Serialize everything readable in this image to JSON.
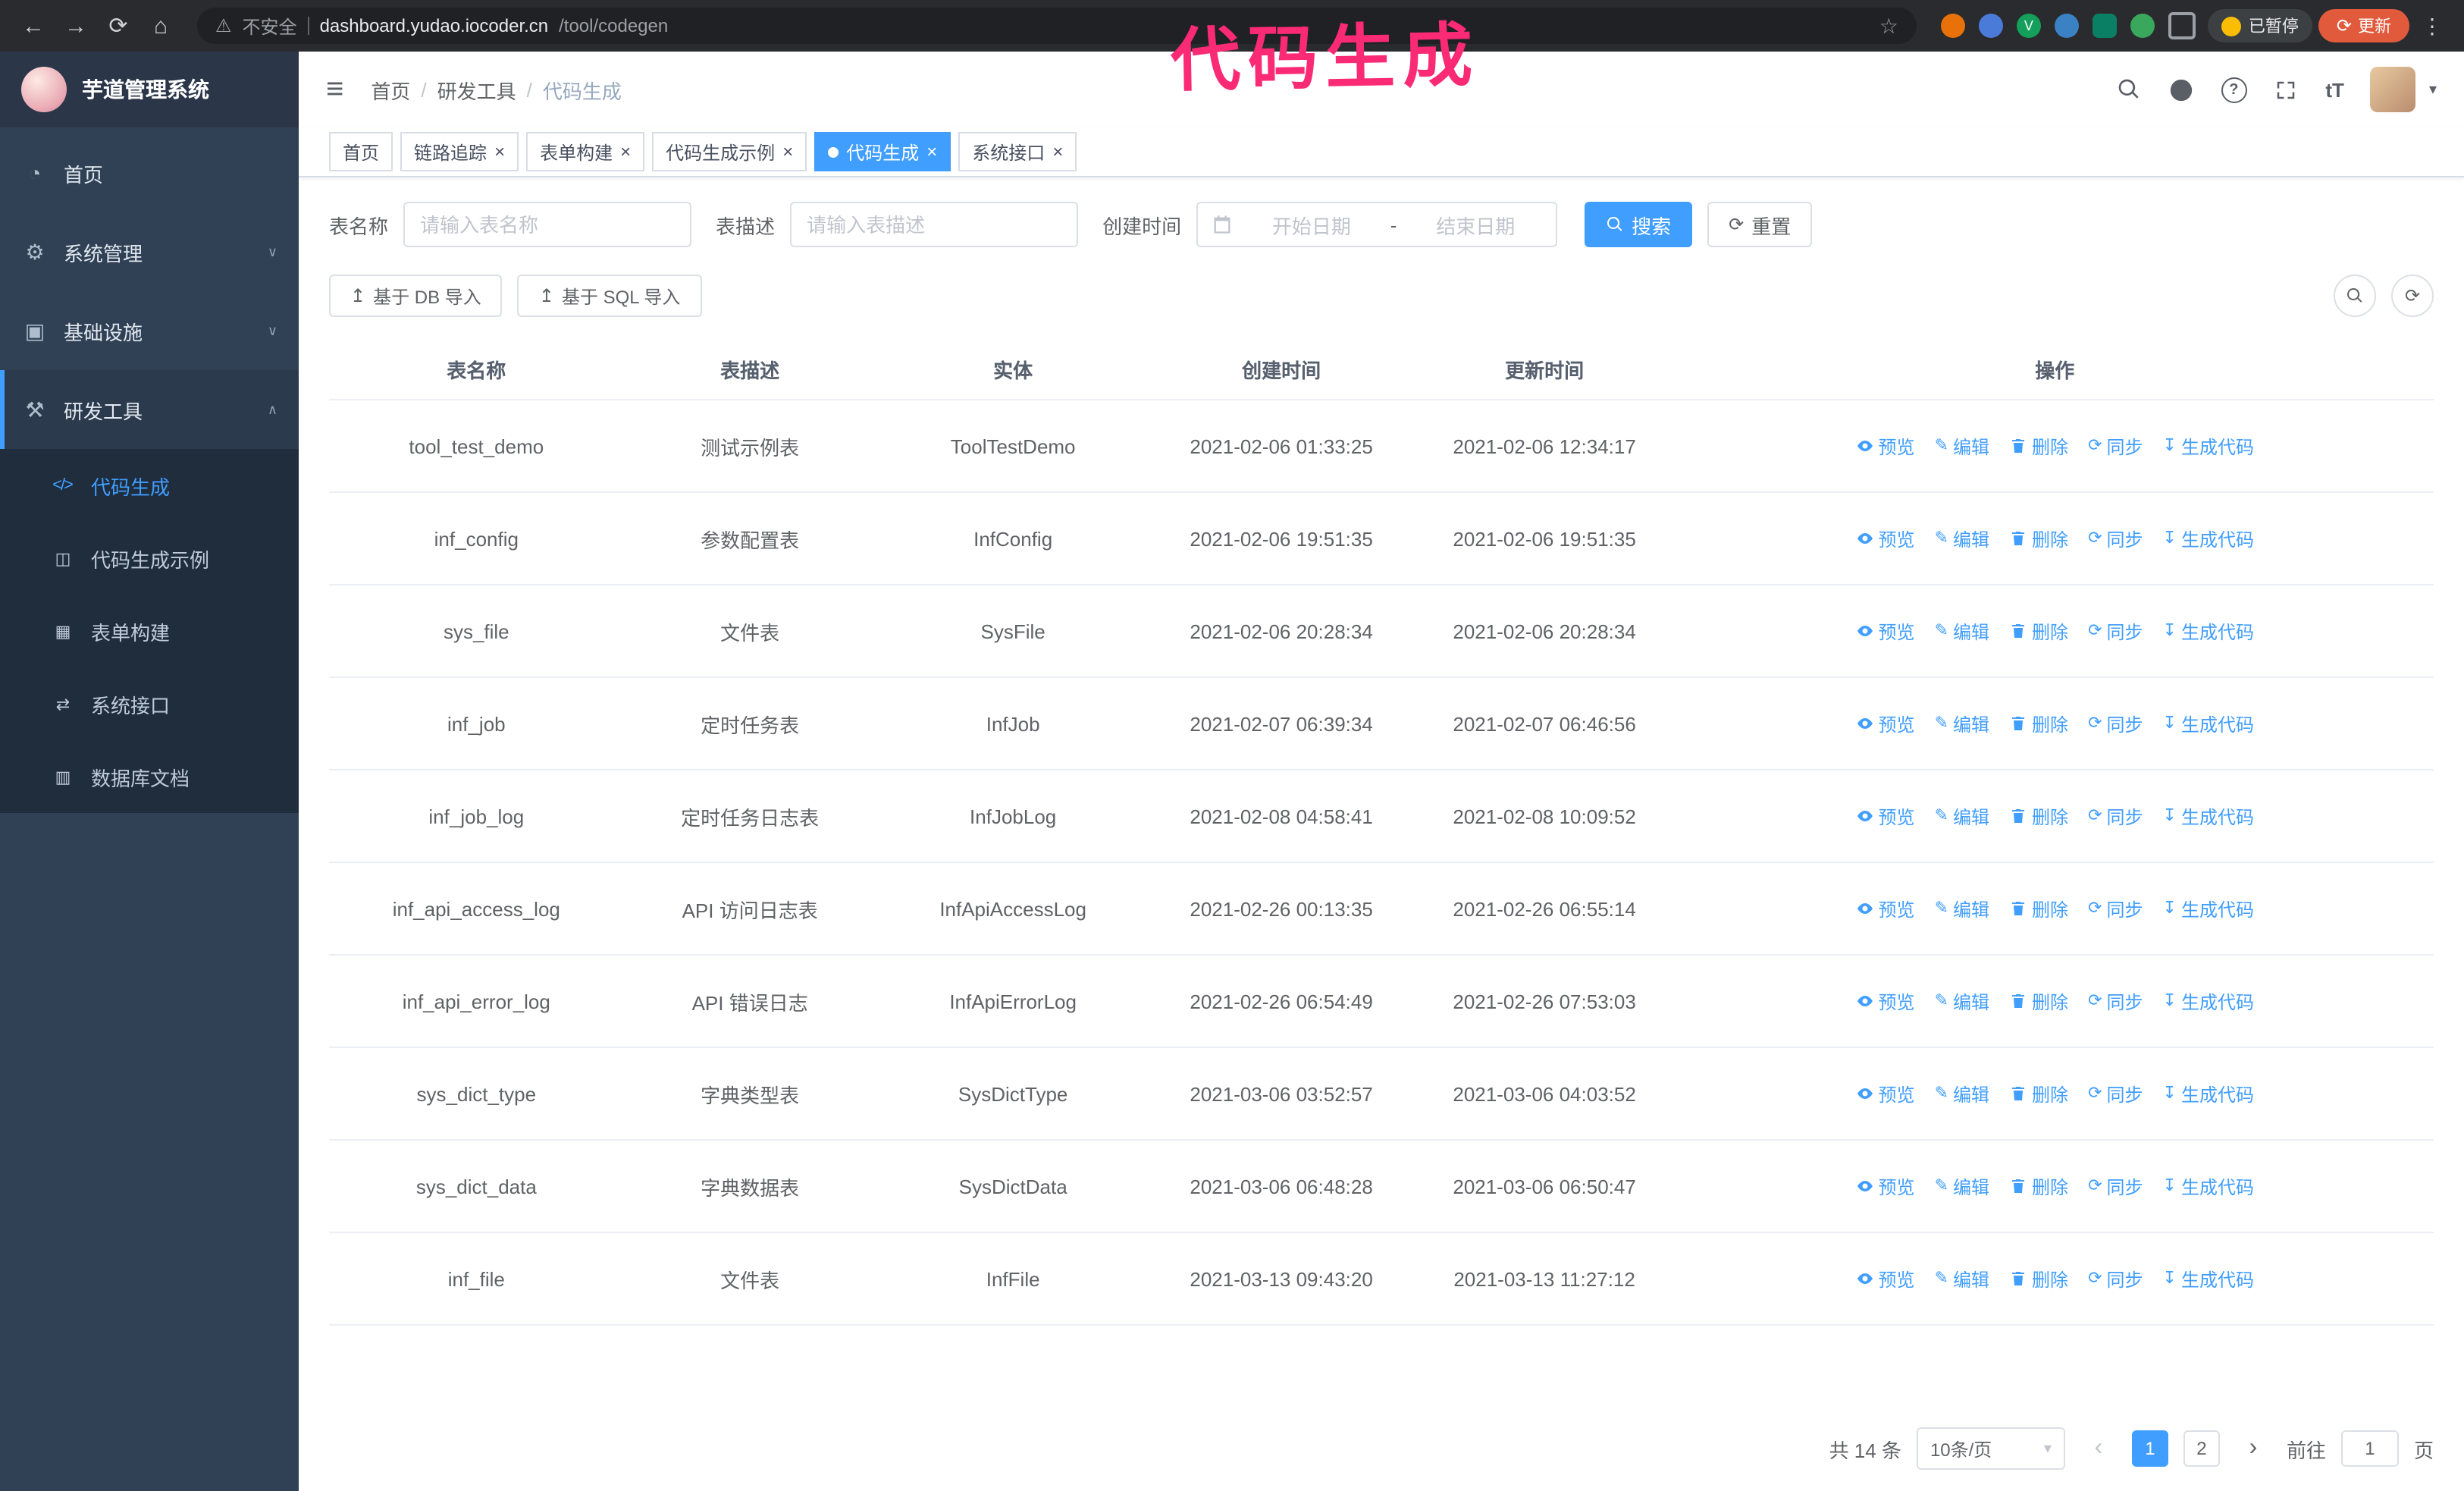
{
  "browser": {
    "security_label": "不安全",
    "url_host": "dashboard.yudao.iocoder.cn",
    "url_path": "/tool/codegen",
    "paused_badge": "已暂停",
    "update_button": "更新",
    "extension_badge_v": "V"
  },
  "annotation": "代码生成",
  "sidebar": {
    "logo_title": "芋道管理系统",
    "items": [
      {
        "label": "首页"
      },
      {
        "label": "系统管理"
      },
      {
        "label": "基础设施"
      },
      {
        "label": "研发工具"
      }
    ],
    "subitems": [
      {
        "label": "代码生成",
        "active": true
      },
      {
        "label": "代码生成示例"
      },
      {
        "label": "表单构建"
      },
      {
        "label": "系统接口"
      },
      {
        "label": "数据库文档"
      }
    ]
  },
  "header": {
    "breadcrumb": [
      "首页",
      "研发工具",
      "代码生成"
    ]
  },
  "tabs": [
    {
      "label": "首页"
    },
    {
      "label": "链路追踪"
    },
    {
      "label": "表单构建"
    },
    {
      "label": "代码生成示例"
    },
    {
      "label": "代码生成"
    },
    {
      "label": "系统接口"
    }
  ],
  "filters": {
    "table_name_label": "表名称",
    "table_name_placeholder": "请输入表名称",
    "table_desc_label": "表描述",
    "table_desc_placeholder": "请输入表描述",
    "create_time_label": "创建时间",
    "date_start_placeholder": "开始日期",
    "date_separator": "-",
    "date_end_placeholder": "结束日期",
    "search_button": "搜索",
    "reset_button": "重置"
  },
  "toolbar": {
    "import_db_button": "基于 DB 导入",
    "import_sql_button": "基于 SQL 导入"
  },
  "table": {
    "columns": [
      "表名称",
      "表描述",
      "实体",
      "创建时间",
      "更新时间",
      "操作"
    ],
    "ops": [
      "预览",
      "编辑",
      "删除",
      "同步",
      "生成代码"
    ],
    "rows": [
      {
        "name": "tool_test_demo",
        "desc": "测试示例表",
        "entity": "ToolTestDemo",
        "created": "2021-02-06 01:33:25",
        "updated": "2021-02-06 12:34:17"
      },
      {
        "name": "inf_config",
        "desc": "参数配置表",
        "entity": "InfConfig",
        "created": "2021-02-06 19:51:35",
        "updated": "2021-02-06 19:51:35"
      },
      {
        "name": "sys_file",
        "desc": "文件表",
        "entity": "SysFile",
        "created": "2021-02-06 20:28:34",
        "updated": "2021-02-06 20:28:34"
      },
      {
        "name": "inf_job",
        "desc": "定时任务表",
        "entity": "InfJob",
        "created": "2021-02-07 06:39:34",
        "updated": "2021-02-07 06:46:56"
      },
      {
        "name": "inf_job_log",
        "desc": "定时任务日志表",
        "entity": "InfJobLog",
        "created": "2021-02-08 04:58:41",
        "updated": "2021-02-08 10:09:52"
      },
      {
        "name": "inf_api_access_log",
        "desc": "API 访问日志表",
        "entity": "InfApiAccessLog",
        "created": "2021-02-26 00:13:35",
        "updated": "2021-02-26 06:55:14"
      },
      {
        "name": "inf_api_error_log",
        "desc": "API 错误日志",
        "entity": "InfApiErrorLog",
        "created": "2021-02-26 06:54:49",
        "updated": "2021-02-26 07:53:03"
      },
      {
        "name": "sys_dict_type",
        "desc": "字典类型表",
        "entity": "SysDictType",
        "created": "2021-03-06 03:52:57",
        "updated": "2021-03-06 04:03:52"
      },
      {
        "name": "sys_dict_data",
        "desc": "字典数据表",
        "entity": "SysDictData",
        "created": "2021-03-06 06:48:28",
        "updated": "2021-03-06 06:50:47"
      },
      {
        "name": "inf_file",
        "desc": "文件表",
        "entity": "InfFile",
        "created": "2021-03-13 09:43:20",
        "updated": "2021-03-13 11:27:12"
      }
    ]
  },
  "pagination": {
    "total": "共 14 条",
    "page_size": "10条/页",
    "pages": [
      "1",
      "2"
    ],
    "goto_label": "前往",
    "goto_value": "1",
    "page_unit": "页"
  },
  "icons": {
    "back": "←",
    "forward": "→",
    "reload": "⟳",
    "home": "⌂",
    "warning": "⚠",
    "star": "☆",
    "kebab": "⋮",
    "hamburger": "≡",
    "close": "×",
    "chevron_down": "∨",
    "chevron_up": "∧",
    "caret_down": "▾",
    "question": "?",
    "font_size": "tT",
    "menu_home": "◔",
    "menu_system": "⚙",
    "menu_infra": "▣",
    "menu_tools": "⚒",
    "sub_code": "</>",
    "sub_example": "◫",
    "sub_form": "▦",
    "sub_api": "⇄",
    "sub_db": "▥",
    "edit": "✎",
    "sync": "⟳",
    "download": "↧",
    "upload": "↥",
    "prev": "‹",
    "next": "›",
    "breadcrumb_sep": "/"
  },
  "colors": {
    "primary": "#409eff",
    "sidebar_bg": "#304156",
    "submenu_bg": "#1f2d3d",
    "annotation_pink": "#fa2a74",
    "table_border": "#ebeef5",
    "active_tab": "#409eff"
  }
}
